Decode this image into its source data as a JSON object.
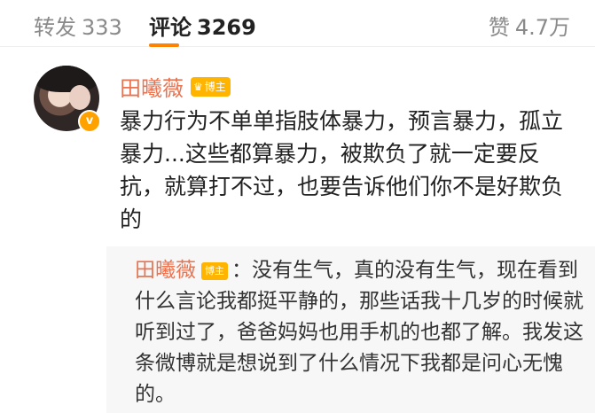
{
  "tabs": {
    "repost_label": "转发",
    "repost_count": "333",
    "comment_label": "评论",
    "comment_count": "3269",
    "like_label": "赞",
    "like_count": "4.7万"
  },
  "comment": {
    "username": "田曦薇",
    "tag": "博主",
    "avatar_badge": "v",
    "text": "暴力行为不单单指肢体暴力，预言暴力，孤立暴力...这些都算暴力，被欺负了就一定要反抗，就算打不过，也要告诉他们你不是好欺负的"
  },
  "reply": {
    "username": "田曦薇",
    "tag": "博主",
    "text": "：没有生气，真的没有生气，现在看到什么言论我都挺平静的，那些话我十几岁的时候就听到过了，爸爸妈妈也用手机的也都了解。我发这条微博就是想说到了什么情况下我都是问心无愧的。"
  },
  "colors": {
    "accent": "#ff8200",
    "username": "#eb7350",
    "tag_bg": "#ffb400",
    "reply_bg": "#f7f7f7"
  },
  "icons": {
    "verify": "verified-badge-icon",
    "tag": "crown-icon"
  }
}
